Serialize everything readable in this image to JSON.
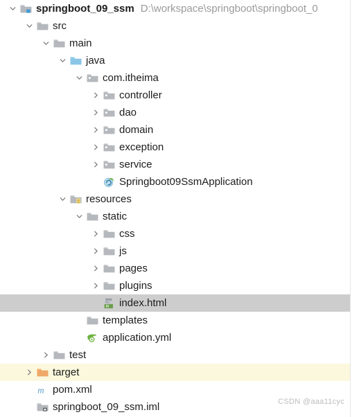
{
  "header": {
    "project_name": "springboot_09_ssm",
    "project_path": "D:\\workspace\\springboot\\springboot_0"
  },
  "watermark": "CSDN @aaa11cyc",
  "colors": {
    "selection": "#cdcdcd",
    "excluded_row": "#fbf8dd",
    "folder_gray": "#b5b9bd",
    "folder_source_blue": "#89c6e8",
    "folder_excluded_orange": "#f0a868",
    "resources_yellow": "#e8c44a",
    "spring_green": "#6db33f",
    "maven_blue": "#5a9ec9",
    "html_green": "#6a9e4a",
    "text": "#1c1c1c",
    "path_text": "#9a9a9a"
  },
  "tree": [
    {
      "label": "springboot_09_ssm",
      "depth": 0,
      "twisty": "expanded",
      "icon": "module-folder-icon",
      "bold": true,
      "path": "D:\\workspace\\springboot\\springboot_0",
      "state": "normal"
    },
    {
      "label": "src",
      "depth": 1,
      "twisty": "expanded",
      "icon": "folder-icon",
      "bold": false,
      "path": "",
      "state": "normal"
    },
    {
      "label": "main",
      "depth": 2,
      "twisty": "expanded",
      "icon": "folder-icon",
      "bold": false,
      "path": "",
      "state": "normal"
    },
    {
      "label": "java",
      "depth": 3,
      "twisty": "expanded",
      "icon": "source-folder-icon",
      "bold": false,
      "path": "",
      "state": "normal"
    },
    {
      "label": "com.itheima",
      "depth": 4,
      "twisty": "expanded",
      "icon": "package-icon",
      "bold": false,
      "path": "",
      "state": "normal"
    },
    {
      "label": "controller",
      "depth": 5,
      "twisty": "collapsed",
      "icon": "package-icon",
      "bold": false,
      "path": "",
      "state": "normal"
    },
    {
      "label": "dao",
      "depth": 5,
      "twisty": "collapsed",
      "icon": "package-icon",
      "bold": false,
      "path": "",
      "state": "normal"
    },
    {
      "label": "domain",
      "depth": 5,
      "twisty": "collapsed",
      "icon": "package-icon",
      "bold": false,
      "path": "",
      "state": "normal"
    },
    {
      "label": "exception",
      "depth": 5,
      "twisty": "collapsed",
      "icon": "package-icon",
      "bold": false,
      "path": "",
      "state": "normal"
    },
    {
      "label": "service",
      "depth": 5,
      "twisty": "collapsed",
      "icon": "package-icon",
      "bold": false,
      "path": "",
      "state": "normal"
    },
    {
      "label": "Springboot09SsmApplication",
      "depth": 5,
      "twisty": "none",
      "icon": "spring-class-icon",
      "bold": false,
      "path": "",
      "state": "normal"
    },
    {
      "label": "resources",
      "depth": 3,
      "twisty": "expanded",
      "icon": "resources-folder-icon",
      "bold": false,
      "path": "",
      "state": "normal"
    },
    {
      "label": "static",
      "depth": 4,
      "twisty": "expanded",
      "icon": "folder-icon",
      "bold": false,
      "path": "",
      "state": "normal"
    },
    {
      "label": "css",
      "depth": 5,
      "twisty": "collapsed",
      "icon": "folder-icon",
      "bold": false,
      "path": "",
      "state": "normal"
    },
    {
      "label": "js",
      "depth": 5,
      "twisty": "collapsed",
      "icon": "folder-icon",
      "bold": false,
      "path": "",
      "state": "normal"
    },
    {
      "label": "pages",
      "depth": 5,
      "twisty": "collapsed",
      "icon": "folder-icon",
      "bold": false,
      "path": "",
      "state": "normal"
    },
    {
      "label": "plugins",
      "depth": 5,
      "twisty": "collapsed",
      "icon": "folder-icon",
      "bold": false,
      "path": "",
      "state": "normal"
    },
    {
      "label": "index.html",
      "depth": 5,
      "twisty": "none",
      "icon": "html-file-icon",
      "bold": false,
      "path": "",
      "state": "selected"
    },
    {
      "label": "templates",
      "depth": 4,
      "twisty": "none",
      "icon": "folder-icon",
      "bold": false,
      "path": "",
      "state": "normal"
    },
    {
      "label": "application.yml",
      "depth": 4,
      "twisty": "none",
      "icon": "spring-config-icon",
      "bold": false,
      "path": "",
      "state": "normal"
    },
    {
      "label": "test",
      "depth": 2,
      "twisty": "collapsed",
      "icon": "folder-icon",
      "bold": false,
      "path": "",
      "state": "normal"
    },
    {
      "label": "target",
      "depth": 1,
      "twisty": "collapsed",
      "icon": "excluded-folder-icon",
      "bold": false,
      "path": "",
      "state": "excluded"
    },
    {
      "label": "pom.xml",
      "depth": 1,
      "twisty": "none",
      "icon": "maven-file-icon",
      "bold": false,
      "path": "",
      "state": "normal"
    },
    {
      "label": "springboot_09_ssm.iml",
      "depth": 1,
      "twisty": "none",
      "icon": "iml-file-icon",
      "bold": false,
      "path": "",
      "state": "normal"
    }
  ]
}
